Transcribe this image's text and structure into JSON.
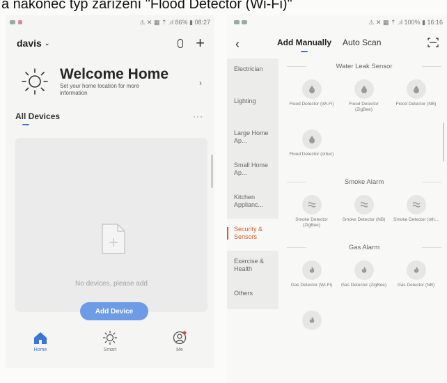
{
  "caption": "a nakonec typ zařízení \"Flood Detector (Wi-Fi)\"",
  "left_phone": {
    "status": {
      "right": "⚠ ✕ ▦ ⇡ .ıl 86% ▮ 08:27"
    },
    "home_name": "davis",
    "welcome": {
      "title": "Welcome Home",
      "subtitle": "Set your home location for more information"
    },
    "devices_title": "All Devices",
    "more": "···",
    "empty_text": "No devices, please add",
    "add_button": "Add Device",
    "tabs": [
      {
        "label": "Home",
        "icon": "home-icon",
        "active": true
      },
      {
        "label": "Smart",
        "icon": "sun-icon",
        "active": false
      },
      {
        "label": "Me",
        "icon": "profile-icon",
        "active": false
      }
    ]
  },
  "right_phone": {
    "status": {
      "right": "⚠ ✕ ▦ ⇡ .ıl 100% ▮ 16:16"
    },
    "tab_manual": "Add Manually",
    "tab_auto": "Auto Scan",
    "categories": [
      {
        "label": "Electrician",
        "active": false
      },
      {
        "label": "Lighting",
        "active": false
      },
      {
        "label": "Large Home Ap...",
        "active": false
      },
      {
        "label": "Small Home Ap...",
        "active": false
      },
      {
        "label": "Kitchen Applianc...",
        "active": false
      },
      {
        "label": "Security & Sensors",
        "active": true
      },
      {
        "label": "Exercise & Health",
        "active": false
      },
      {
        "label": "Others",
        "active": false
      }
    ],
    "sections": [
      {
        "title": "Water Leak Sensor",
        "icon": "water-drop-icon",
        "devices": [
          "Flood Detector (Wi-Fi)",
          "Flood Detector (ZigBee)",
          "Flood Detector (NB)",
          "Flood Detector (other)"
        ]
      },
      {
        "title": "Smoke Alarm",
        "icon": "smoke-icon",
        "devices": [
          "Smoke Detector (ZigBee)",
          "Smoke Detector (NB)",
          "Smoke Detector (oth..."
        ]
      },
      {
        "title": "Gas Alarm",
        "icon": "flame-icon",
        "devices": [
          "Gas Detector (Wi-Fi)",
          "Gas Detector (ZigBee)",
          "Gas Detector (NB)",
          ""
        ]
      }
    ]
  },
  "colors": {
    "accent": "#3b74d8",
    "add_button": "#6d9be6",
    "active_category": "#d0602a"
  }
}
